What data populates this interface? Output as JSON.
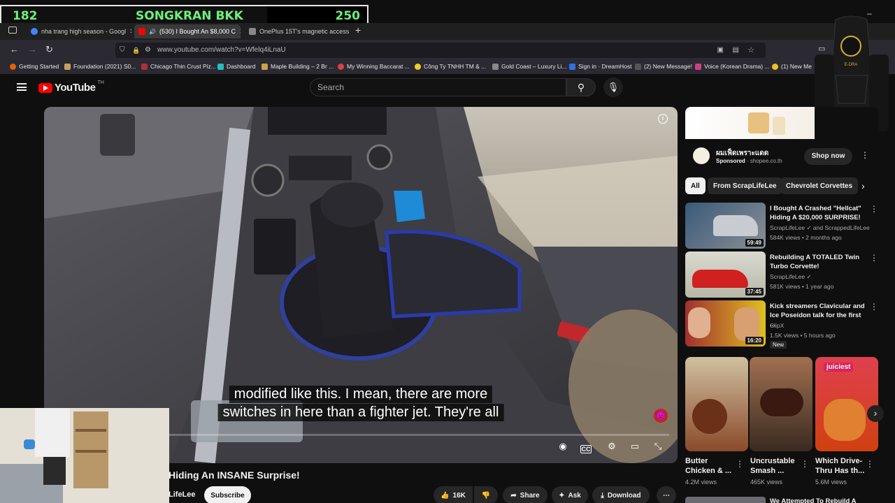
{
  "overlay": {
    "left_number": "182",
    "left_title": "SONGKRAN BKK",
    "right_number": "250"
  },
  "tabs": [
    {
      "label": "nha trang high season - Googl",
      "fav": "#4285f4"
    },
    {
      "label": "(530) I Bought An $8,000 C",
      "fav": "#ff0000",
      "active": true
    },
    {
      "label": "OnePlus 15T's magnetic access",
      "fav": "#888888"
    }
  ],
  "browser": {
    "url": "www.youtube.com/watch?v=Wfelq4iLnaU"
  },
  "bookmarks": [
    {
      "label": "Getting Started",
      "color": "#e66000"
    },
    {
      "label": "Foundation (2021) S0...",
      "color": "#c8a060"
    },
    {
      "label": "Chicago Thin Crust Piz...",
      "color": "#b03030"
    },
    {
      "label": "Dashboard",
      "color": "#20c0c0"
    },
    {
      "label": "Maple Building – 2 Br ...",
      "color": "#d0a050"
    },
    {
      "label": "My Winning Baccarat ...",
      "color": "#e04040"
    },
    {
      "label": "Công Ty TNHH TM & ...",
      "color": "#f0d020"
    },
    {
      "label": "Gold Coast – Luxury Li...",
      "color": "#888888"
    },
    {
      "label": "Sign in · DreamHost",
      "color": "#3070e0"
    },
    {
      "label": "(2) New Message!",
      "color": "#555555"
    },
    {
      "label": "Voice (Korean Drama) ...",
      "color": "#d04080"
    },
    {
      "label": "(1) New Me",
      "color": "#f0c020"
    }
  ],
  "youtube": {
    "logo": "YouTube",
    "country": "TH",
    "search_placeholder": "Search"
  },
  "video": {
    "caption_line1": "modified like this. I mean, there are more",
    "caption_line2": "switches in here than a fighter jet. They're all",
    "title": "Hiding An INSANE Surprise!",
    "channel": "LifeLee",
    "subscribe": "Subscribe",
    "likes": "16K",
    "share": "Share",
    "ask": "Ask",
    "download": "Download"
  },
  "ad": {
    "title": "ผมเฟ็ดเพราะแดด",
    "sponsored": "Sponsored",
    "domain": "shopee.co.th",
    "cta": "Shop now"
  },
  "chips": [
    "All",
    "From ScrapLifeLee",
    "Chevrolet Corvettes"
  ],
  "related": [
    {
      "title": "I Bought A Crashed \"Hellcat\" Hiding A $20,000 SURPRISE!",
      "channel": "ScrapLifeLee ✓ and ScrappedLifeLee",
      "meta": "584K views • 2 months ago",
      "duration": "59:49",
      "c1": "#3a5a7a",
      "c2": "#8a8f95"
    },
    {
      "title": "Rebuilding A TOTALED Twin Turbo Corvette!",
      "channel": "ScrapLifeLee ✓",
      "meta": "581K views • 1 year ago",
      "duration": "37:45",
      "c1": "#d02020",
      "c2": "#d9d9d0"
    },
    {
      "title": "Kick streamers Clavicular and Ice Poseidon talk for the first ...",
      "channel": "ClipX",
      "meta": "1.5K views • 5 hours ago",
      "duration": "16:20",
      "badge": "New",
      "c1": "#a03030",
      "c2": "#e0c020"
    }
  ],
  "shorts": [
    {
      "title": "Butter Chicken & ...",
      "views": "4.2M views",
      "c1": "#8a4a2a",
      "c2": "#d0c0a0"
    },
    {
      "title": "Uncrustable Smash ...",
      "views": "465K views",
      "c1": "#3a2a20",
      "c2": "#a07050"
    },
    {
      "title": "Which Drive-Thru Has th...",
      "views": "5.6M views",
      "badge": "juiciest",
      "c1": "#d04010",
      "c2": "#e0a050"
    }
  ],
  "next_title": "We Attempted To Rebuild A"
}
